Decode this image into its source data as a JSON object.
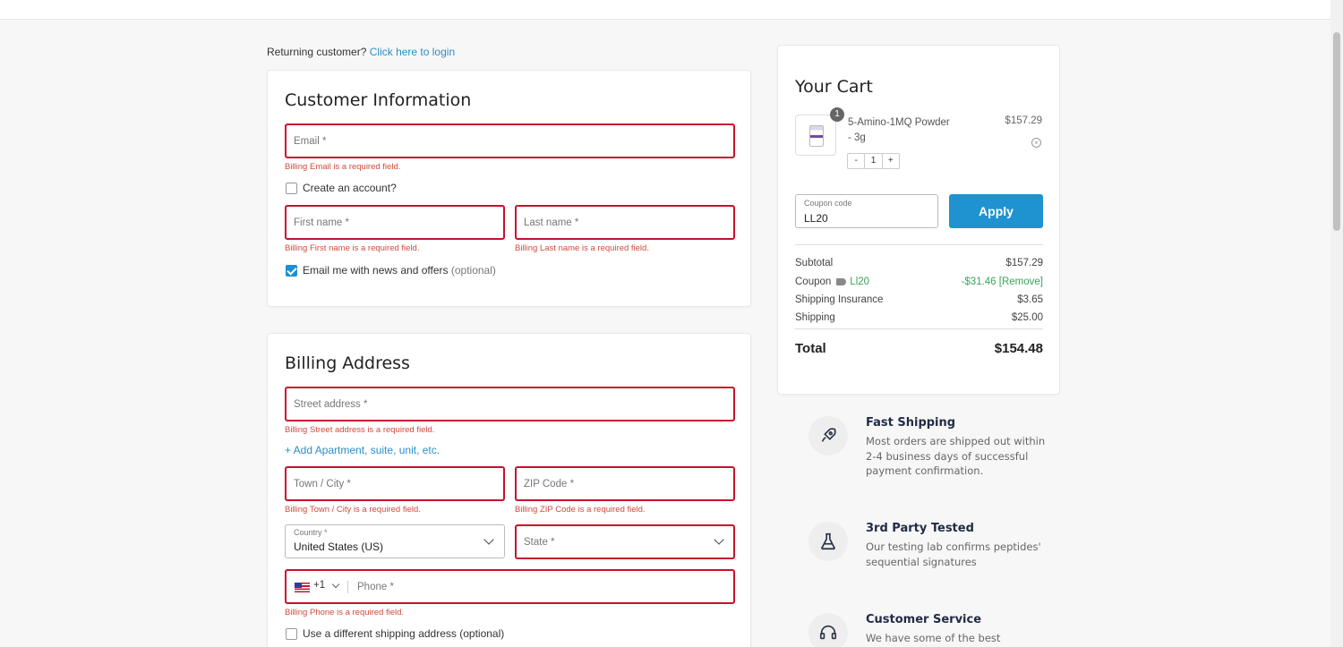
{
  "returning": {
    "text": "Returning customer?",
    "link": "Click here to login"
  },
  "customer_info": {
    "title": "Customer Information",
    "email_placeholder": "Email *",
    "email_error": "Billing Email is a required field.",
    "create_account_label": "Create an account?",
    "first_name_placeholder": "First name *",
    "first_name_error": "Billing First name is a required field.",
    "last_name_placeholder": "Last name *",
    "last_name_error": "Billing Last name is a required field.",
    "newsletter_label": "Email me with news and offers",
    "newsletter_optional": "(optional)",
    "newsletter_checked": true
  },
  "billing": {
    "title": "Billing Address",
    "street_placeholder": "Street address *",
    "street_error": "Billing Street address is a required field.",
    "add_apartment": "+ Add Apartment, suite, unit, etc.",
    "city_placeholder": "Town / City *",
    "city_error": "Billing Town / City is a required field.",
    "zip_placeholder": "ZIP Code *",
    "zip_error": "Billing ZIP Code is a required field.",
    "country_label": "Country *",
    "country_value": "United States (US)",
    "state_placeholder": "State *",
    "phone_code": "+1",
    "phone_placeholder": "Phone *",
    "phone_error": "Billing Phone is a required field.",
    "diff_shipping_label": "Use a different shipping address (optional)"
  },
  "cart": {
    "title": "Your Cart",
    "item": {
      "name": "5-Amino-1MQ Powder - 3g",
      "price": "$157.29",
      "qty": "1",
      "badge": "1"
    },
    "stepper": {
      "minus": "-",
      "plus": "+"
    },
    "coupon_label": "Coupon code",
    "coupon_value": "LL20",
    "apply_label": "Apply",
    "subtotal_label": "Subtotal",
    "subtotal_value": "$157.29",
    "coupon_row_label": "Coupon",
    "coupon_row_code": "Ll20",
    "coupon_row_value": "-$31.46 [Remove]",
    "insurance_label": "Shipping Insurance",
    "insurance_value": "$3.65",
    "shipping_label": "Shipping",
    "shipping_value": "$25.00",
    "total_label": "Total",
    "total_value": "$154.48"
  },
  "features": [
    {
      "icon": "rocket-icon",
      "title": "Fast Shipping",
      "desc": "Most orders are shipped out within 2-4 business days of successful payment confirmation."
    },
    {
      "icon": "flask-icon",
      "title": "3rd Party Tested",
      "desc": "Our testing lab confirms peptides' sequential signatures"
    },
    {
      "icon": "headset-icon",
      "title": "Customer Service",
      "desc": "We have some of the best customer service around"
    }
  ],
  "colors": {
    "accent": "#1f93cf",
    "error": "#c8102e",
    "success": "#3aa55a"
  }
}
